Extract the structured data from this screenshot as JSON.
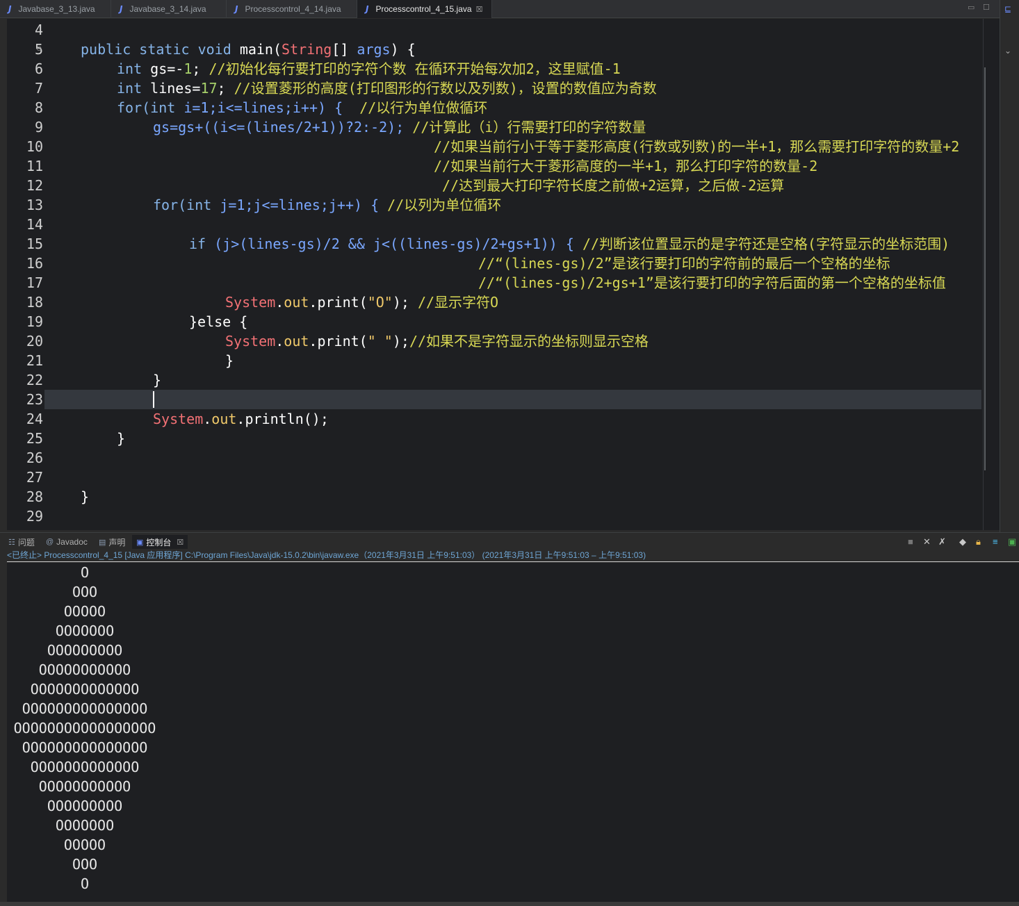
{
  "tabs": [
    {
      "label": "Javabase_3_13.java",
      "active": false
    },
    {
      "label": "Javabase_3_14.java",
      "active": false
    },
    {
      "label": "Processcontrol_4_14.java",
      "active": false
    },
    {
      "label": "Processcontrol_4_15.java",
      "active": true
    }
  ],
  "tab_close": "☒",
  "editor": {
    "line_numbers": [
      "4",
      "5",
      "6",
      "7",
      "8",
      "9",
      "10",
      "11",
      "12",
      "13",
      "14",
      "15",
      "16",
      "17",
      "18",
      "19",
      "20",
      "21",
      "22",
      "23",
      "24",
      "25",
      "26",
      "27",
      "28",
      "29"
    ],
    "current_line": "23",
    "code": {
      "l5": {
        "kw1": "public",
        "kw2": "static",
        "kw3": "void",
        "name": "main(",
        "type": "String",
        "rest1": "[] ",
        "arg": "args",
        "rest2": ") {"
      },
      "l6": {
        "kw": "int",
        "var": "gs",
        "op": "=-",
        "num": "1",
        "semi": "; ",
        "comment": "//初始化每行要打印的字符个数 在循环开始每次加2，这里赋值-1"
      },
      "l7": {
        "kw": "int",
        "var": "lines",
        "op": "=",
        "num": "17",
        "semi": "; ",
        "comment": "//设置菱形的高度(打印图形的行数以及列数)，设置的数值应为奇数"
      },
      "l8": {
        "kw1": "for(",
        "kw2": "int",
        "code": " i=1;i<=lines;i++) {  ",
        "comment": "//以行为单位做循环"
      },
      "l9": {
        "code": "gs=gs+((i<=(lines/2+1))?2:-2); ",
        "comment": "//计算此（i）行需要打印的字符数量"
      },
      "l10": {
        "comment": "//如果当前行小于等于菱形高度(行数或列数)的一半+1，那么需要打印字符的数量+2"
      },
      "l11": {
        "comment": "//如果当前行大于菱形高度的一半+1，那么打印字符的数量-2"
      },
      "l12": {
        "comment": "//达到最大打印字符长度之前做+2运算，之后做-2运算"
      },
      "l13": {
        "kw1": "for(",
        "kw2": "int",
        "code": " j=1;j<=lines;j++) { ",
        "comment": "//以列为单位循环"
      },
      "l15": {
        "kw": "if",
        "code": " (j>(lines-gs)/2 && j<((lines-gs)/2+gs+1)) { ",
        "comment": "//判断该位置显示的是字符还是空格(字符显示的坐标范围)"
      },
      "l16": {
        "comment": "//“(lines-gs)/2”是该行要打印的字符前的最后一个空格的坐标"
      },
      "l17": {
        "comment": "//“(lines-gs)/2+gs+1”是该行要打印的字符后面的第一个空格的坐标值"
      },
      "l18": {
        "sys": "System",
        "dot1": ".",
        "out": "out",
        "call": ".print(",
        "str": "\"O\"",
        "end": "); ",
        "comment": "//显示字符O"
      },
      "l19": {
        "code": "}else {"
      },
      "l20": {
        "sys": "System",
        "dot1": ".",
        "out": "out",
        "call": ".print(",
        "str": "\" \"",
        "end": ");",
        "comment": "//如果不是字符显示的坐标则显示空格"
      },
      "l21": {
        "code": "}"
      },
      "l22": {
        "code": "}"
      },
      "l24": {
        "sys": "System",
        "dot1": ".",
        "out": "out",
        "call": ".println();"
      },
      "l25": {
        "code": "}"
      },
      "l28": {
        "code": "}"
      }
    }
  },
  "console_tabs": [
    {
      "label": "问题",
      "icon": "problems-icon"
    },
    {
      "label": "Javadoc",
      "icon": "at-icon"
    },
    {
      "label": "声明",
      "icon": "declaration-icon"
    },
    {
      "label": "控制台",
      "icon": "console-icon",
      "active": true
    }
  ],
  "console_status": "<已终止> Processcontrol_4_15 [Java 应用程序] C:\\Program Files\\Java\\jdk-15.0.2\\bin\\javaw.exe（2021年3月31日 上午9:51:03） (2021年3月31日 上午9:51:03 – 上午9:51:03)",
  "console_output": [
    "O",
    "OOO",
    "OOOOO",
    "OOOOOOO",
    "OOOOOOOOO",
    "OOOOOOOOOOO",
    "OOOOOOOOOOOOO",
    "OOOOOOOOOOOOOOO",
    "OOOOOOOOOOOOOOOOO",
    "OOOOOOOOOOOOOOO",
    "OOOOOOOOOOOOO",
    "OOOOOOOOOOO",
    "OOOOOOOOO",
    "OOOOOOO",
    "OOOOO",
    "OOO",
    "O"
  ],
  "colors": {
    "keyword": "#86b4e8",
    "comment": "#d8d854",
    "number": "#a6d06a",
    "system": "#f27175",
    "string": "#f0c96a"
  }
}
